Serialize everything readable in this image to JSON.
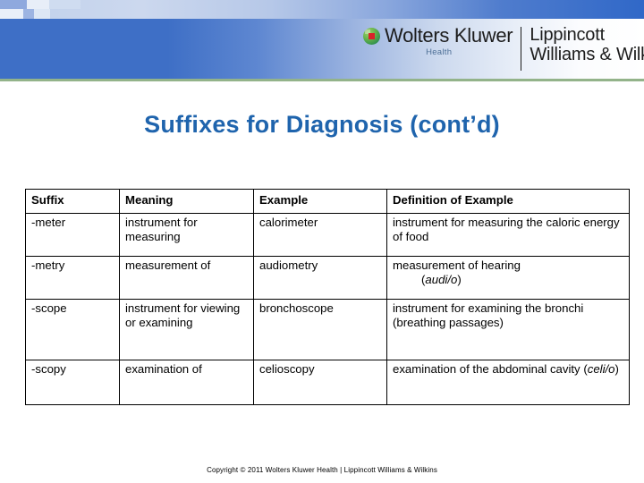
{
  "banner": {
    "logo": {
      "globe_icon": "wolters-kluwer-globe-icon",
      "brand_primary": "Wolters Kluwer",
      "brand_sub": "Health",
      "brand_secondary_line1": "Lippincott",
      "brand_secondary_line2": "Williams & Wilkins"
    },
    "colors": {
      "band_blue": "#3e6fc6",
      "green_rule": "#93b38a",
      "globe_green": "#63b24a",
      "globe_square_red": "#d8232a",
      "health_text": "#4d6f96"
    }
  },
  "slide": {
    "title": "Suffixes for Diagnosis (cont’d)",
    "title_color": "#1f64ad"
  },
  "table": {
    "columns": [
      "Suffix",
      "Meaning",
      "Example",
      "Definition of Example"
    ],
    "rows": [
      {
        "suffix": "-meter",
        "meaning": "instrument for measuring",
        "example": "calorimeter",
        "definition": "instrument for measuring the caloric energy of food",
        "definition_indent": "",
        "definition_term": ""
      },
      {
        "suffix": "-metry",
        "meaning": "measurement of",
        "example": "audiometry",
        "definition": "measurement of hearing",
        "definition_indent_prefix": "(",
        "definition_term": "audi/o",
        "definition_indent_suffix": ")"
      },
      {
        "suffix": "-scope",
        "meaning": "instrument for viewing or examining",
        "example": "bronchoscope",
        "definition": "instrument for examining the bronchi (breathing passages)",
        "definition_indent": "",
        "definition_term": ""
      },
      {
        "suffix": "-scopy",
        "meaning": "examination of",
        "example": "celioscopy",
        "definition_part1": "examination of the abdominal cavity (",
        "definition_term": "celi/o",
        "definition_part2": ")"
      }
    ]
  },
  "footer": {
    "copyright": "Copyright © 2011 Wolters Kluwer Health | Lippincott Williams & Wilkins"
  }
}
